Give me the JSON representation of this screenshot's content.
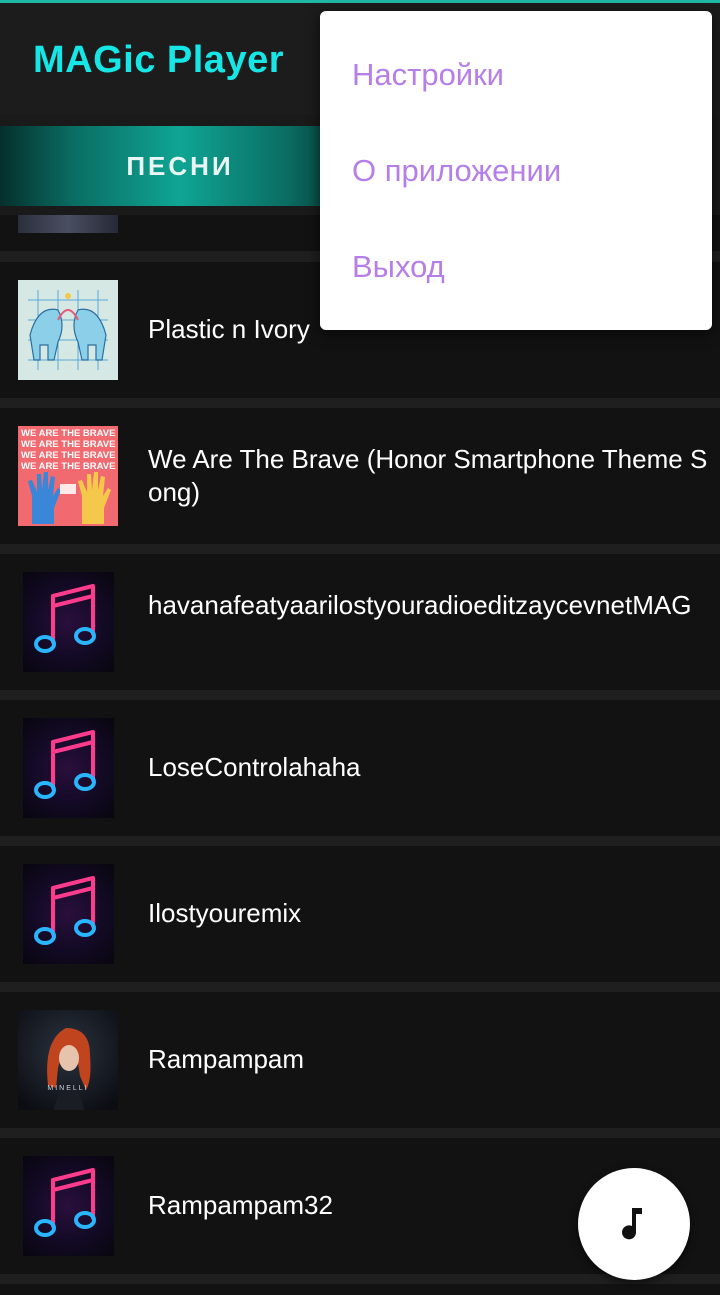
{
  "app": {
    "title": "MAGic Player"
  },
  "tabs": [
    {
      "label": "ПЕСНИ",
      "selected": true
    }
  ],
  "menu": {
    "items": [
      {
        "label": "Настройки"
      },
      {
        "label": "О приложении"
      },
      {
        "label": "Выход"
      }
    ]
  },
  "songs": [
    {
      "title": "",
      "art": "album-art-partial"
    },
    {
      "title": "Plastic n Ivory",
      "art": "album-art-elephants"
    },
    {
      "title": "We Are The Brave (Honor Smartphone Theme Song)",
      "art": "album-art-brave",
      "art_text": "WE ARE THE BRAVE"
    },
    {
      "title": "havanafeatyaarilostyouradioeditzaycevnetMAG",
      "art": "music-note-icon"
    },
    {
      "title": "LoseControlahaha",
      "art": "music-note-icon"
    },
    {
      "title": "Ilostyouremix",
      "art": "music-note-icon"
    },
    {
      "title": "Rampampam",
      "art": "album-art-minelli",
      "art_text": "MINELLI"
    },
    {
      "title": "Rampampam32",
      "art": "music-note-icon"
    }
  ],
  "fab": {
    "icon": "music-note-icon"
  },
  "colors": {
    "accent": "#16e6e6",
    "tab_gradient": "#0fa594",
    "menu_text": "#b57ee8",
    "row_bg": "#121212",
    "divider": "#252525"
  }
}
